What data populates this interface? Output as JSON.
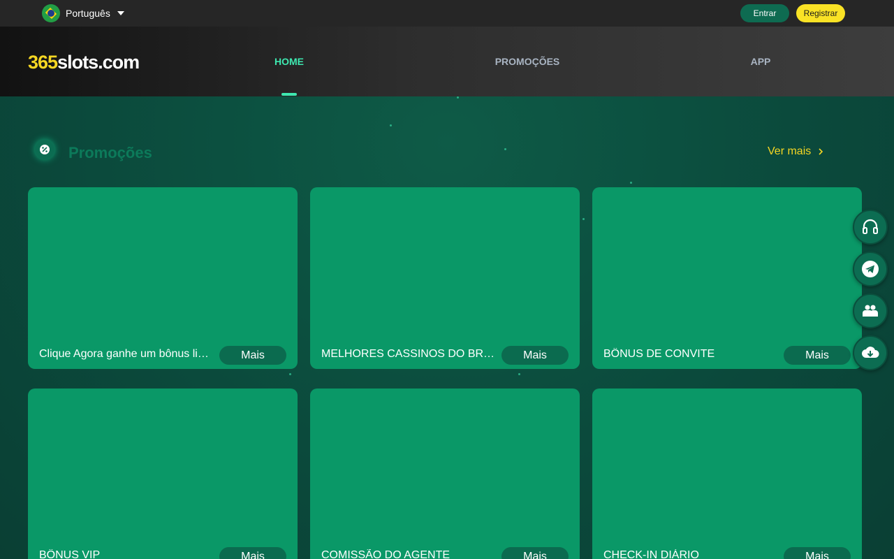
{
  "topbar": {
    "language": "Português",
    "login_label": "Entrar",
    "register_label": "Registrar"
  },
  "header": {
    "logo_number": "365",
    "logo_text": "slots.com",
    "nav": [
      {
        "label": "HOME",
        "active": true
      },
      {
        "label": "PROMOÇÕES",
        "active": false
      },
      {
        "label": "APP",
        "active": false
      }
    ]
  },
  "section": {
    "title": "Promoções",
    "see_more": "Ver mais"
  },
  "cards": [
    {
      "title": "Clique Agora ganhe um bônus limitado",
      "button": "Mais"
    },
    {
      "title": "MELHORES CASSINOS DO BRASIL",
      "button": "Mais"
    },
    {
      "title": "BÔNUS DE CONVITE",
      "button": "Mais"
    },
    {
      "title": "BÔNUS VIP",
      "button": "Mais"
    },
    {
      "title": "COMISSÃO DO AGENTE",
      "button": "Mais"
    },
    {
      "title": "CHECK-IN DIÁRIO",
      "button": "Mais"
    }
  ],
  "floating": [
    "headset-icon",
    "telegram-icon",
    "users-icon",
    "download-cloud-icon"
  ],
  "colors": {
    "accent": "#3ee8b0",
    "brand_yellow": "#f5d623",
    "card": "#0a9867",
    "background": "#0b4a3c"
  }
}
